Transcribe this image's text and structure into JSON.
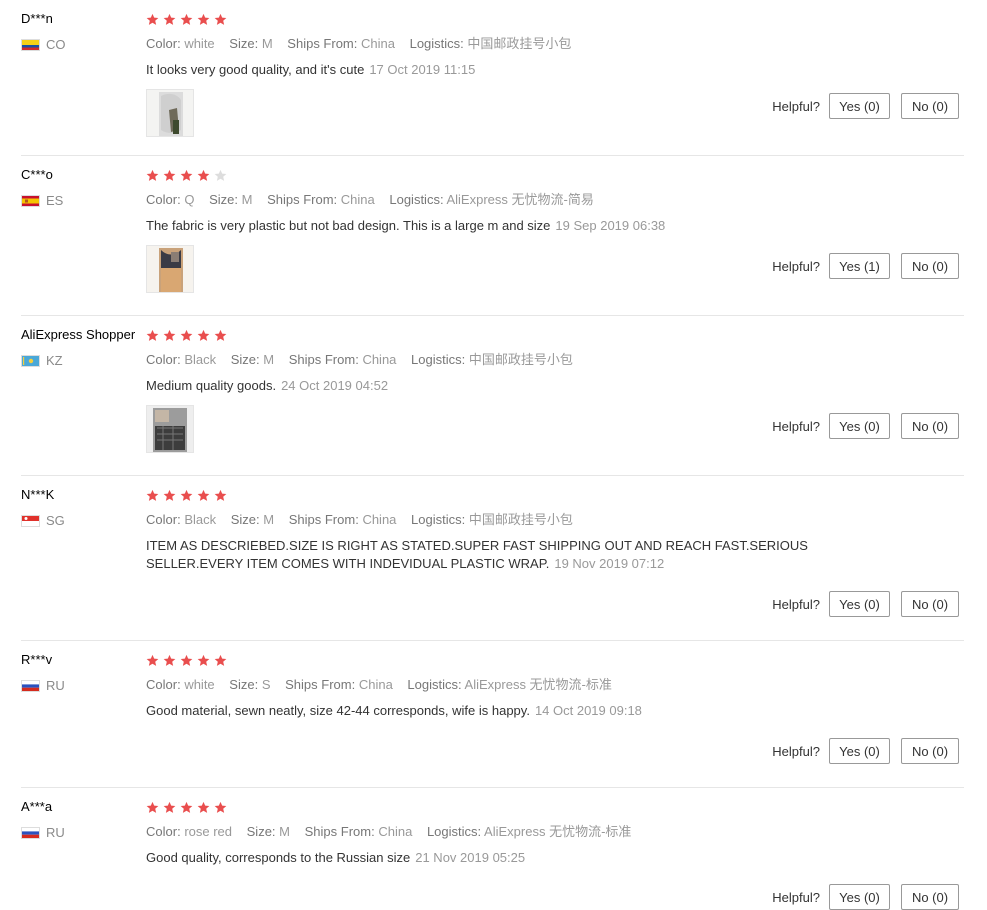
{
  "labels": {
    "color": "Color:",
    "size": "Size:",
    "ships_from": "Ships From:",
    "logistics": "Logistics:",
    "helpful": "Helpful?"
  },
  "colors": {
    "star_on": "#e94e4e",
    "star_off": "#dddddd"
  },
  "reviews": [
    {
      "user": "D***n",
      "country": "CO",
      "flag": "colombia-flag-icon",
      "rating": 5,
      "color": "white",
      "size": "M",
      "ships_from": "China",
      "logistics": "中国邮政挂号小包",
      "text": "It looks very good quality, and it's cute",
      "date": "17 Oct 2019 11:15",
      "has_photo": true,
      "yes": "Yes (0)",
      "no": "No (0)"
    },
    {
      "user": "C***o",
      "country": "ES",
      "flag": "spain-flag-icon",
      "rating": 4,
      "color": "Q",
      "size": "M",
      "ships_from": "China",
      "logistics": "AliExpress 无忧物流-简易",
      "text": "The fabric is very plastic but not bad design. This is a large m and size",
      "date": "19 Sep 2019 06:38",
      "has_photo": true,
      "yes": "Yes (1)",
      "no": "No (0)"
    },
    {
      "user": "AliExpress Shopper",
      "country": "KZ",
      "flag": "kazakhstan-flag-icon",
      "rating": 5,
      "color": "Black",
      "size": "M",
      "ships_from": "China",
      "logistics": "中国邮政挂号小包",
      "text": "Medium quality goods.",
      "date": "24 Oct 2019 04:52",
      "has_photo": true,
      "yes": "Yes (0)",
      "no": "No (0)"
    },
    {
      "user": "N***K",
      "country": "SG",
      "flag": "singapore-flag-icon",
      "rating": 5,
      "color": "Black",
      "size": "M",
      "ships_from": "China",
      "logistics": "中国邮政挂号小包",
      "text": "ITEM AS DESCRIEBED.SIZE IS RIGHT AS STATED.SUPER FAST SHIPPING OUT AND REACH FAST.SERIOUS SELLER.EVERY ITEM COMES WITH INDEVIDUAL PLASTIC WRAP.",
      "date": "19 Nov 2019 07:12",
      "has_photo": false,
      "yes": "Yes (0)",
      "no": "No (0)"
    },
    {
      "user": "R***v",
      "country": "RU",
      "flag": "russia-flag-icon",
      "rating": 5,
      "color": "white",
      "size": "S",
      "ships_from": "China",
      "logistics": "AliExpress 无忧物流-标准",
      "text": "Good material, sewn neatly, size 42-44 corresponds, wife is happy.",
      "date": "14 Oct 2019 09:18",
      "has_photo": false,
      "yes": "Yes (0)",
      "no": "No (0)"
    },
    {
      "user": "A***a",
      "country": "RU",
      "flag": "russia-flag-icon",
      "rating": 5,
      "color": "rose red",
      "size": "M",
      "ships_from": "China",
      "logistics": "AliExpress 无忧物流-标准",
      "text": "Good quality, corresponds to the Russian size",
      "date": "21 Nov 2019 05:25",
      "has_photo": false,
      "yes": "Yes (0)",
      "no": "No (0)"
    }
  ]
}
